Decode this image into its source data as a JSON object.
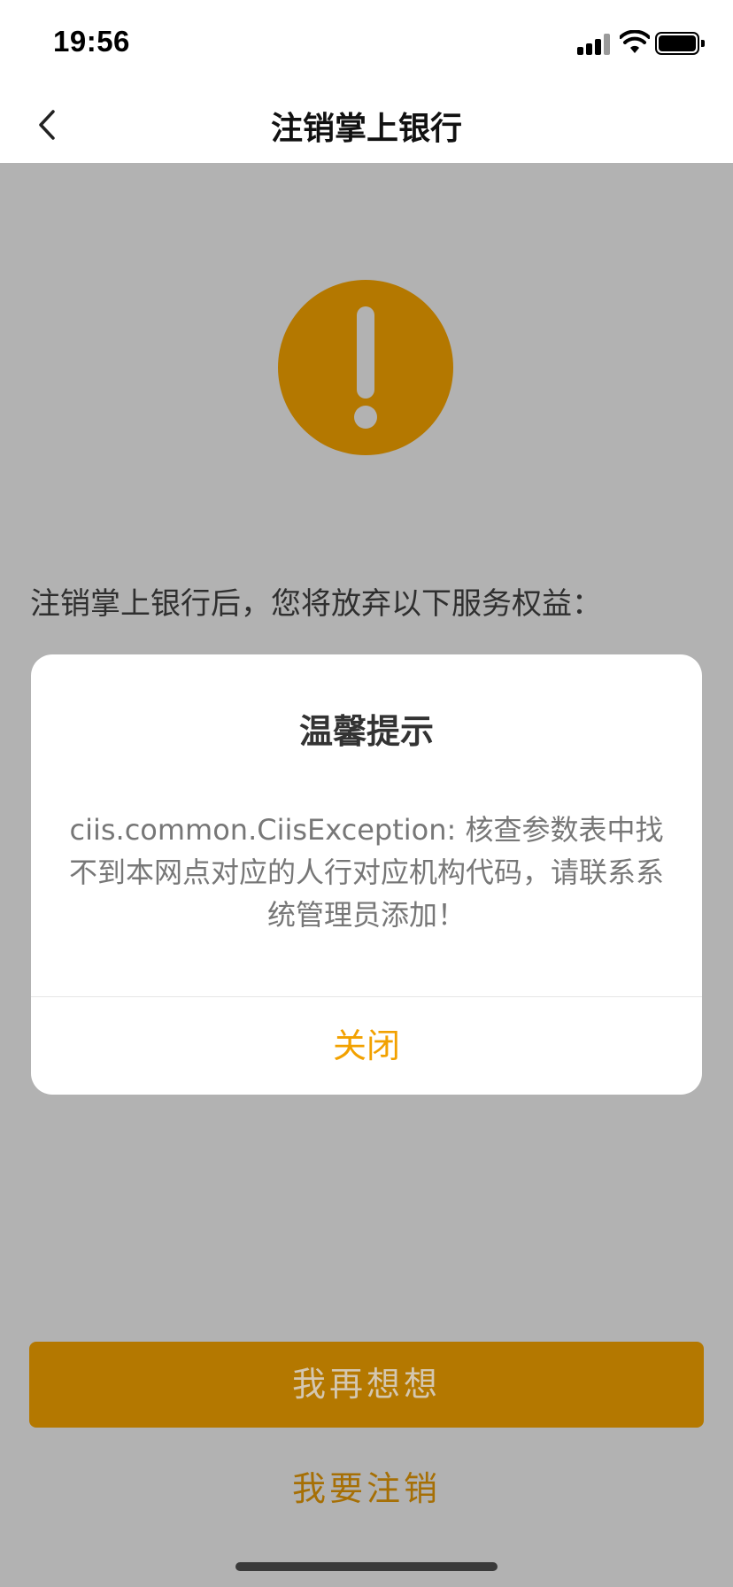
{
  "status_bar": {
    "time": "19:56",
    "icons": [
      "cellular-signal-icon",
      "wifi-icon",
      "battery-icon"
    ]
  },
  "nav": {
    "back_icon": "chevron-left-icon",
    "title": "注销掌上银行"
  },
  "warning_icon": "exclamation-circle-icon",
  "intro_text": "注销掌上银行后，您将放弃以下服务权益：",
  "dialog": {
    "title": "温馨提示",
    "message": "ciis.common.CiisException: 核查参数表中找不到本网点对应的人行对应机构代码，请联系系统管理员添加！",
    "close_label": "关闭"
  },
  "actions": {
    "reconsider_label": "我再想想",
    "cancel_account_label": "我要注销"
  },
  "colors": {
    "accent": "#B47800",
    "dialog_button": "#F2A100",
    "overlay_background": "#B2B2B2"
  }
}
